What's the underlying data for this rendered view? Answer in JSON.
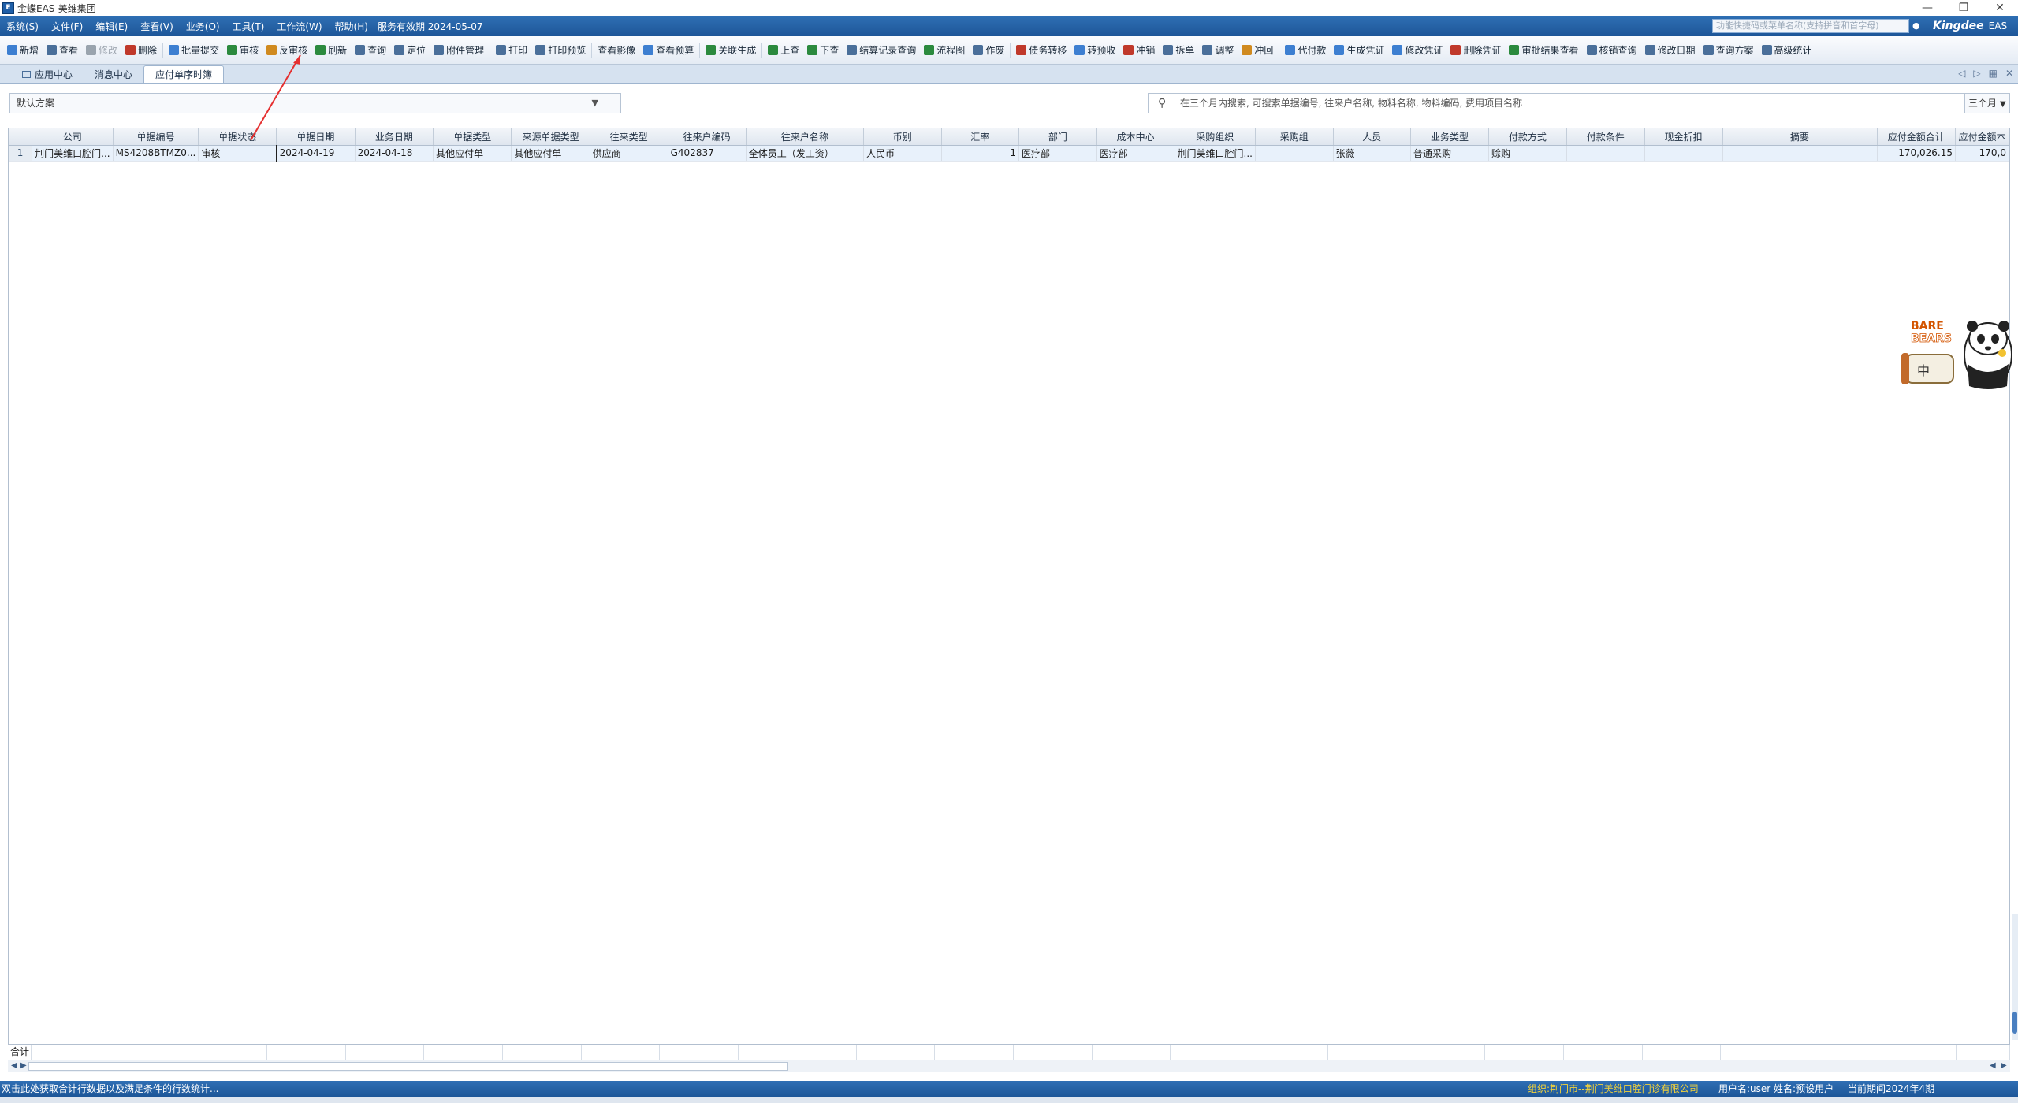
{
  "window": {
    "title": "金蝶EAS-美维集团",
    "minimize": "—",
    "restore": "❐",
    "close": "✕"
  },
  "menubar": {
    "items": [
      "系统(S)",
      "文件(F)",
      "编辑(E)",
      "查看(V)",
      "业务(O)",
      "工具(T)",
      "工作流(W)",
      "帮助(H)"
    ],
    "service_date": "服务有效期 2024-05-07",
    "search_placeholder": "功能快捷码或菜单名称(支持拼音和首字母)",
    "brand": "Kingdee",
    "brand_suffix": "EAS"
  },
  "toolbar": {
    "buttons": [
      {
        "label": "新增",
        "icon": "new-doc-icon",
        "color": "#3d7fd1",
        "enabled": true
      },
      {
        "label": "查看",
        "icon": "view-icon",
        "color": "#4a6f9a",
        "enabled": true
      },
      {
        "label": "修改",
        "icon": "edit-icon",
        "color": "#9aa4ae",
        "enabled": false
      },
      {
        "label": "删除",
        "icon": "delete-icon",
        "color": "#c0392b",
        "enabled": true
      },
      {
        "label": "批量提交",
        "icon": "batch-submit-icon",
        "color": "#3d7fd1",
        "enabled": true
      },
      {
        "label": "审核",
        "icon": "audit-icon",
        "color": "#2b8a3e",
        "enabled": true
      },
      {
        "label": "反审核",
        "icon": "unaudit-icon",
        "color": "#d08a1f",
        "enabled": true
      },
      {
        "label": "刷新",
        "icon": "refresh-icon",
        "color": "#2b8a3e",
        "enabled": true
      },
      {
        "label": "查询",
        "icon": "filter-icon",
        "color": "#4a6f9a",
        "enabled": true
      },
      {
        "label": "定位",
        "icon": "locate-icon",
        "color": "#4a6f9a",
        "enabled": true
      },
      {
        "label": "附件管理",
        "icon": "attachment-icon",
        "color": "#4a6f9a",
        "enabled": true
      },
      {
        "label": "打印",
        "icon": "print-icon",
        "color": "#4a6f9a",
        "enabled": true
      },
      {
        "label": "打印预览",
        "icon": "print-preview-icon",
        "color": "#4a6f9a",
        "enabled": true
      },
      {
        "label": "查看影像",
        "icon": "",
        "color": "",
        "enabled": true
      },
      {
        "label": "查看预算",
        "icon": "budget-icon",
        "color": "#3d7fd1",
        "enabled": true
      },
      {
        "label": "关联生成",
        "icon": "link-generate-icon",
        "color": "#2b8a3e",
        "enabled": true
      },
      {
        "label": "上查",
        "icon": "trace-up-icon",
        "color": "#2b8a3e",
        "enabled": true
      },
      {
        "label": "下查",
        "icon": "trace-down-icon",
        "color": "#2b8a3e",
        "enabled": true
      },
      {
        "label": "结算记录查询",
        "icon": "settlement-icon",
        "color": "#4a6f9a",
        "enabled": true
      },
      {
        "label": "流程图",
        "icon": "flowchart-icon",
        "color": "#2b8a3e",
        "enabled": true
      },
      {
        "label": "作废",
        "icon": "void-icon",
        "color": "#4a6f9a",
        "enabled": true
      },
      {
        "label": "债务转移",
        "icon": "debt-transfer-icon",
        "color": "#c0392b",
        "enabled": true
      },
      {
        "label": "转预收",
        "icon": "to-prepay-icon",
        "color": "#3d7fd1",
        "enabled": true
      },
      {
        "label": "冲销",
        "icon": "writeoff-icon",
        "color": "#c0392b",
        "enabled": true
      },
      {
        "label": "拆单",
        "icon": "split-icon",
        "color": "#4a6f9a",
        "enabled": true
      },
      {
        "label": "调整",
        "icon": "adjust-icon",
        "color": "#4a6f9a",
        "enabled": true
      },
      {
        "label": "冲回",
        "icon": "reverse-icon",
        "color": "#d08a1f",
        "enabled": true
      },
      {
        "label": "代付款",
        "icon": "agent-pay-icon",
        "color": "#3d7fd1",
        "enabled": true
      },
      {
        "label": "生成凭证",
        "icon": "voucher-icon",
        "color": "#3d7fd1",
        "enabled": true
      },
      {
        "label": "修改凭证",
        "icon": "edit-voucher-icon",
        "color": "#3d7fd1",
        "enabled": true
      },
      {
        "label": "删除凭证",
        "icon": "delete-voucher-icon",
        "color": "#c0392b",
        "enabled": true
      },
      {
        "label": "审批结果查看",
        "icon": "approval-result-icon",
        "color": "#2b8a3e",
        "enabled": true
      },
      {
        "label": "核销查询",
        "icon": "verify-query-icon",
        "color": "#4a6f9a",
        "enabled": true
      },
      {
        "label": "修改日期",
        "icon": "edit-date-icon",
        "color": "#4a6f9a",
        "enabled": true
      },
      {
        "label": "查询方案",
        "icon": "query-scheme-icon",
        "color": "#4a6f9a",
        "enabled": true
      },
      {
        "label": "高级统计",
        "icon": "advanced-stats-icon",
        "color": "#4a6f9a",
        "enabled": true
      }
    ]
  },
  "tabs": [
    {
      "label": "应用中心",
      "icon": "app-center-icon",
      "active": false
    },
    {
      "label": "消息中心",
      "icon": "",
      "active": false
    },
    {
      "label": "应付单序时簿",
      "icon": "",
      "active": true
    }
  ],
  "filter": {
    "scheme": "默认方案",
    "search_placeholder": "在三个月内搜索, 可搜索单据编号, 往来户名称, 物料名称, 物料编码, 费用项目名称",
    "period": "三个月"
  },
  "grid": {
    "columns": [
      {
        "label": "",
        "w": 30
      },
      {
        "label": "公司",
        "w": 100
      },
      {
        "label": "单据编号",
        "w": 100
      },
      {
        "label": "单据状态",
        "w": 100
      },
      {
        "label": "单据日期",
        "w": 100
      },
      {
        "label": "业务日期",
        "w": 100
      },
      {
        "label": "单据类型",
        "w": 100
      },
      {
        "label": "来源单据类型",
        "w": 100
      },
      {
        "label": "往来类型",
        "w": 100
      },
      {
        "label": "往来户编码",
        "w": 100
      },
      {
        "label": "往来户名称",
        "w": 150
      },
      {
        "label": "币别",
        "w": 100
      },
      {
        "label": "汇率",
        "w": 100
      },
      {
        "label": "部门",
        "w": 100
      },
      {
        "label": "成本中心",
        "w": 100
      },
      {
        "label": "采购组织",
        "w": 100
      },
      {
        "label": "采购组",
        "w": 100
      },
      {
        "label": "人员",
        "w": 100
      },
      {
        "label": "业务类型",
        "w": 100
      },
      {
        "label": "付款方式",
        "w": 100
      },
      {
        "label": "付款条件",
        "w": 100
      },
      {
        "label": "现金折扣",
        "w": 100
      },
      {
        "label": "摘要",
        "w": 200
      },
      {
        "label": "应付金额合计",
        "w": 100
      },
      {
        "label": "应付金额本",
        "w": 68
      }
    ],
    "rows": [
      [
        "1",
        "荆门美维口腔门...",
        "MS4208BTMZ0...",
        "审核",
        "2024-04-19",
        "2024-04-18",
        "其他应付单",
        "其他应付单",
        "供应商",
        "G402837",
        "全体员工（发工资）",
        "人民币",
        "1",
        "医疗部",
        "医疗部",
        "荆门美维口腔门...",
        "",
        "张薇",
        "普通采购",
        "赊购",
        "",
        "",
        "",
        "170,026.15",
        "170,0"
      ]
    ],
    "sum_label": "合计"
  },
  "statusbar": {
    "hint": "双击此处获取合计行数据以及满足条件的行数统计...",
    "org": "组织:荆门市--荆门美维口腔门诊有限公司",
    "user": "用户名:user 姓名:预设用户",
    "period": "当前期间2024年4期"
  },
  "mascot": {
    "brand": "BARE",
    "brand2": "BEARS",
    "badge": "中"
  }
}
